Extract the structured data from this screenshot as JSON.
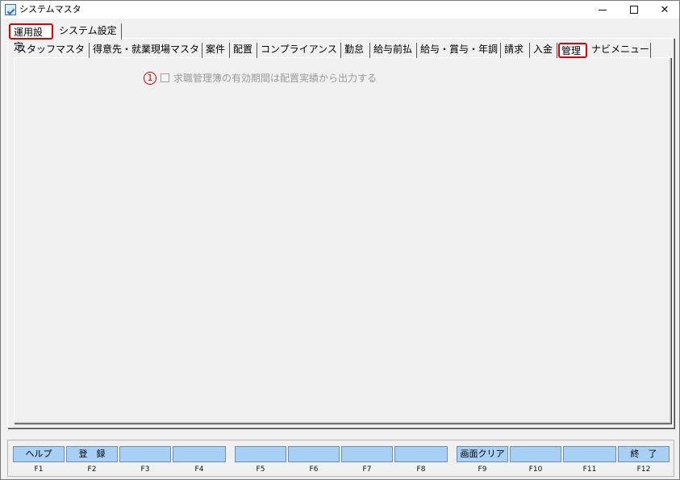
{
  "window": {
    "title": "システムマスタ"
  },
  "top_tabs": [
    {
      "label": "運用設定"
    },
    {
      "label": "システム設定"
    }
  ],
  "sub_tabs": [
    {
      "label": "スタッフマスタ"
    },
    {
      "label": "得意先・就業現場マスタ"
    },
    {
      "label": "案件"
    },
    {
      "label": "配置"
    },
    {
      "label": "コンプライアンス"
    },
    {
      "label": "勤怠"
    },
    {
      "label": "給与前払"
    },
    {
      "label": "給与・賞与・年調"
    },
    {
      "label": "請求"
    },
    {
      "label": "入金"
    },
    {
      "label": "管理"
    },
    {
      "label": "ナビメニュー"
    }
  ],
  "option": {
    "marker": "1",
    "label": "求職管理簿の有効期間は配置実績から出力する"
  },
  "fkeys": [
    {
      "label": "ヘルプ",
      "key": "F1"
    },
    {
      "label": "登　録",
      "key": "F2"
    },
    {
      "label": "",
      "key": "F3"
    },
    {
      "label": "",
      "key": "F4"
    },
    {
      "label": "",
      "key": "F5"
    },
    {
      "label": "",
      "key": "F6"
    },
    {
      "label": "",
      "key": "F7"
    },
    {
      "label": "",
      "key": "F8"
    },
    {
      "label": "画面クリア",
      "key": "F9"
    },
    {
      "label": "",
      "key": "F10"
    },
    {
      "label": "",
      "key": "F11"
    },
    {
      "label": "終　了",
      "key": "F12"
    }
  ]
}
